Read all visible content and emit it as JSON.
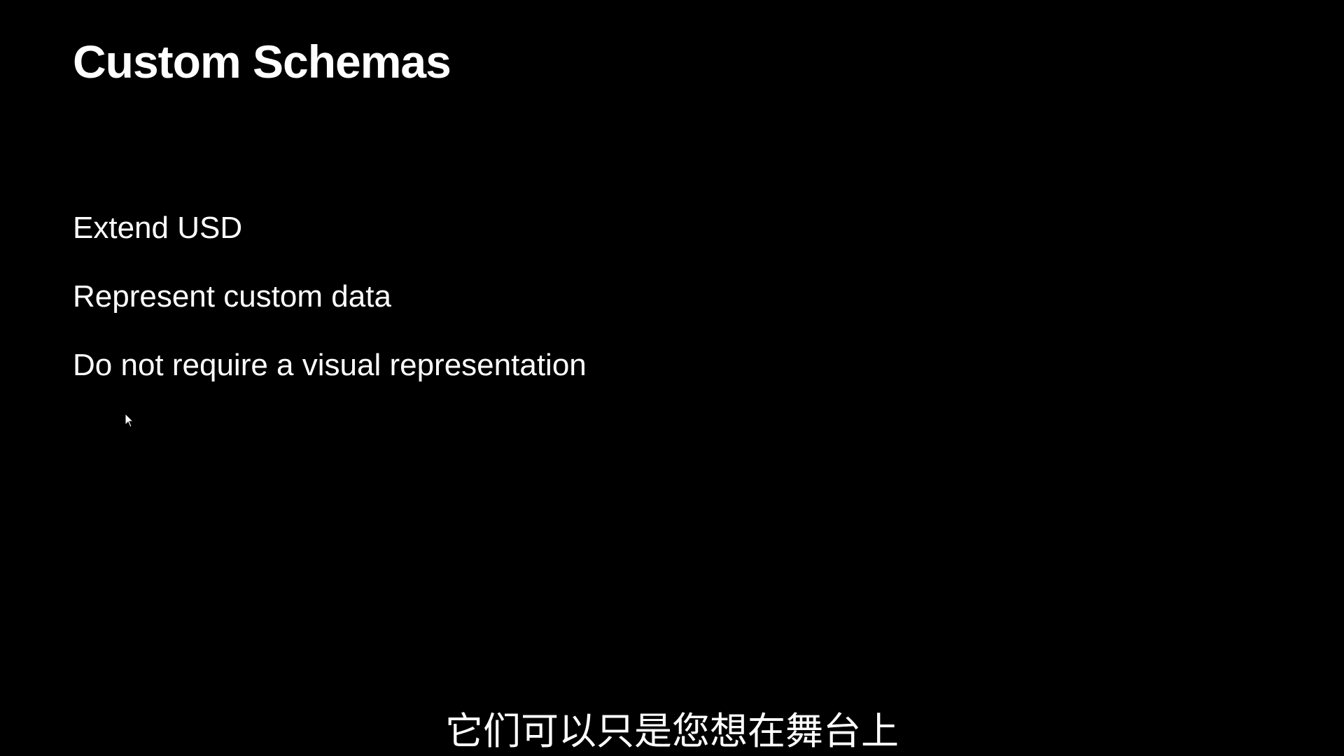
{
  "slide": {
    "title": "Custom Schemas",
    "bullets": [
      "Extend USD",
      "Represent custom data",
      "Do not require a visual representation"
    ]
  },
  "subtitle": "它们可以只是您想在舞台上",
  "icons": {
    "cursor": "mouse-pointer-icon"
  },
  "colors": {
    "background": "#000000",
    "text": "#ffffff"
  }
}
